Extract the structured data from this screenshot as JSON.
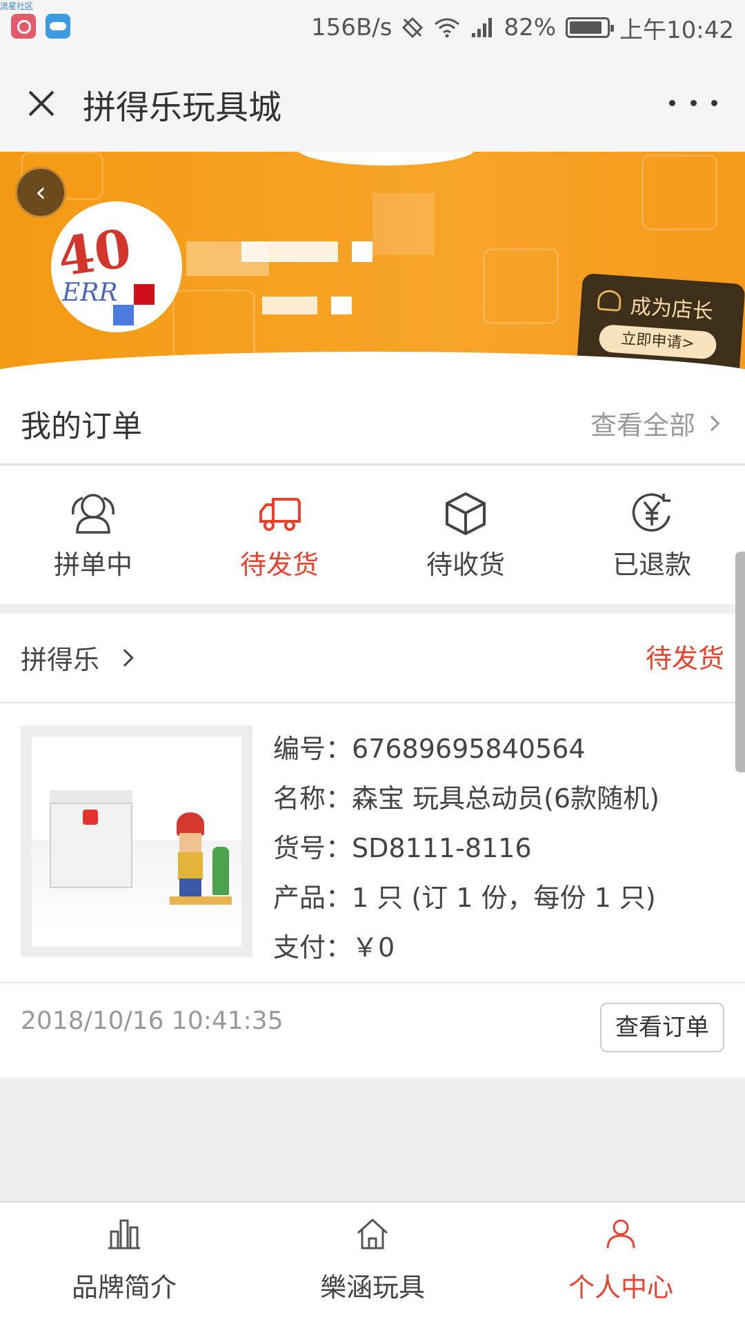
{
  "status_bar": {
    "corner_tag": "流星社区",
    "net_speed": "156B/s",
    "battery_pct": "82%",
    "time": "上午10:42",
    "icons": [
      "no-sim-icon",
      "wifi-icon",
      "signal-icon",
      "battery-icon"
    ]
  },
  "header": {
    "title": "拼得乐玩具城",
    "close_icon": "close-icon",
    "more_icon": "more-dots-icon"
  },
  "banner": {
    "avatar_text_top": "40",
    "avatar_text_bottom": "ERR",
    "shop_badge_title": "成为店长",
    "shop_badge_button": "立即申请>",
    "accent": "#f7a529"
  },
  "orders": {
    "title": "我的订单",
    "view_all": "查看全部"
  },
  "status_tabs": [
    {
      "label": "拼单中",
      "icon": "group-icon",
      "active": false
    },
    {
      "label": "待发货",
      "icon": "truck-icon",
      "active": true
    },
    {
      "label": "待收货",
      "icon": "package-icon",
      "active": false
    },
    {
      "label": "已退款",
      "icon": "refund-icon",
      "active": false
    }
  ],
  "order": {
    "shop_name": "拼得乐",
    "status": "待发货",
    "fields": [
      {
        "label": "编号：",
        "value": "67689695840564"
      },
      {
        "label": "名称：",
        "value": "森宝 玩具总动员(6款随机)"
      },
      {
        "label": "货号：",
        "value": "SD8111-8116"
      },
      {
        "label": "产品：",
        "value": "1 只 (订 1 份，每份 1 只)"
      },
      {
        "label": "支付：",
        "value": "￥0"
      }
    ],
    "time": "2018/10/16 10:41:35",
    "view_button": "查看订单"
  },
  "bottom_nav": [
    {
      "label": "品牌简介",
      "icon": "brand-icon",
      "active": false
    },
    {
      "label": "樂涵玩具",
      "icon": "home-icon",
      "active": false
    },
    {
      "label": "个人中心",
      "icon": "user-icon",
      "active": true
    }
  ],
  "colors": {
    "accent_red": "#e5432f",
    "banner_orange": "#f39a13"
  }
}
